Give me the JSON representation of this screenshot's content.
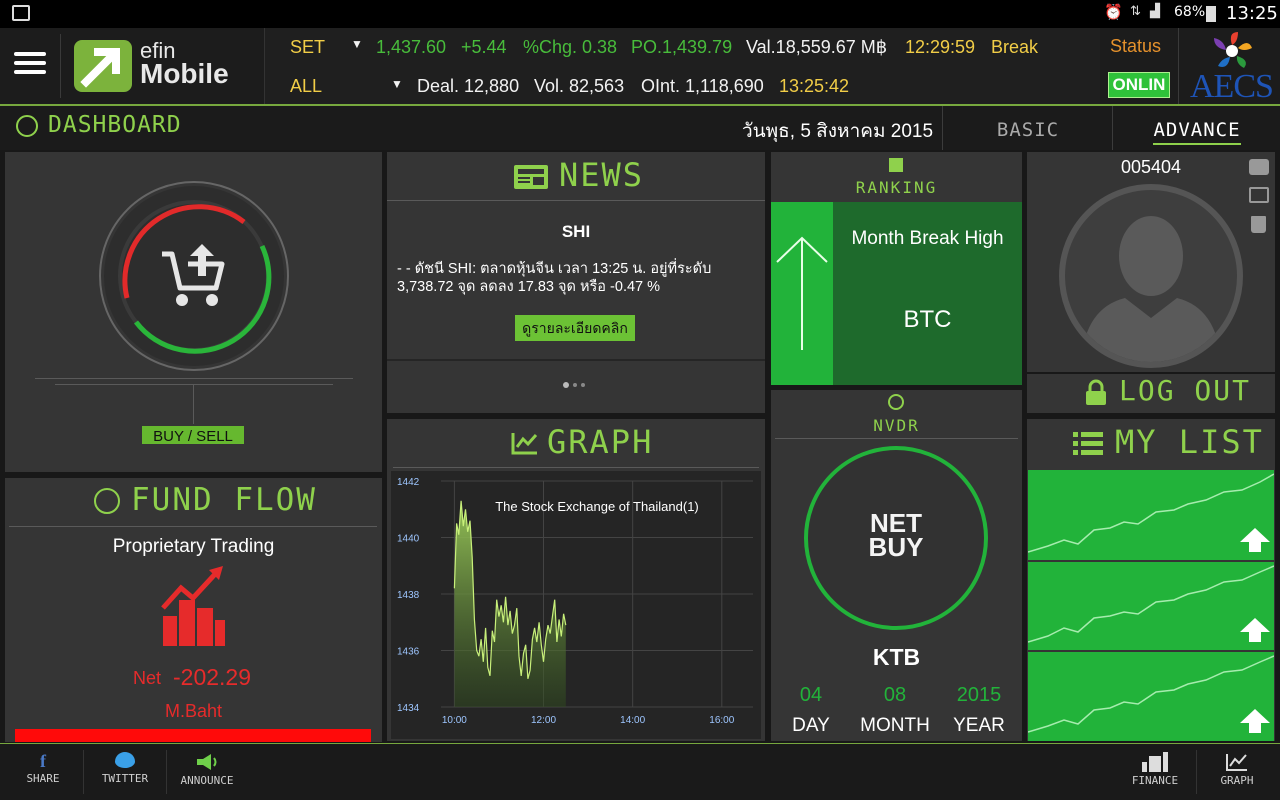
{
  "status_bar": {
    "battery": "68%",
    "time": "13:25"
  },
  "header": {
    "logo_line1": "efin",
    "logo_line2": "Mobile",
    "row1": {
      "market": "SET",
      "index": "1,437.60",
      "change": "+5.44",
      "pct_chg": "%Chg. 0.38",
      "po": "PO.1,439.79",
      "value": "Val.18,559.67 M฿",
      "time": "12:29:59",
      "state": "Break"
    },
    "row2": {
      "market": "ALL",
      "deal": "Deal. 12,880",
      "vol": "Vol. 82,563",
      "oint": "OInt. 1,118,690",
      "time": "13:25:42"
    },
    "status_label": "Status",
    "status_value": "ONLIN",
    "broker_logo": "AECS"
  },
  "dashboard": {
    "title": "DASHBOARD",
    "date": "วันพุธ, 5 สิงหาคม 2015",
    "tab_basic": "BASIC",
    "tab_advance": "ADVANCE"
  },
  "buysell": {
    "label": "BUY / SELL"
  },
  "fund_flow": {
    "title": "FUND FLOW",
    "subtitle": "Proprietary Trading",
    "net_label": "Net",
    "net_value": "-202.29",
    "unit": "M.Baht"
  },
  "news": {
    "title": "NEWS",
    "symbol": "SHI",
    "text": "- - ดัชนี SHI: ตลาดหุ้นจีน  เวลา 13:25 น.  อยู่ที่ระดับ 3,738.72 จุด ลดลง 17.83 จุด หรือ -0.47 %",
    "button": "ดูรายละเอียดคลิก"
  },
  "ranking": {
    "title": "RANKING",
    "label": "Month Break High",
    "symbol": "BTC"
  },
  "profile": {
    "id": "005404",
    "logout": "LOG OUT"
  },
  "graph": {
    "title": "GRAPH"
  },
  "nvdr": {
    "title": "NVDR",
    "circle_line1": "NET",
    "circle_line2": "BUY",
    "symbol": "KTB",
    "day": "04",
    "month": "08",
    "year": "2015",
    "day_label": "DAY",
    "month_label": "MONTH",
    "year_label": "YEAR"
  },
  "mylist": {
    "title": "MY LIST"
  },
  "bottom": {
    "share": "SHARE",
    "twitter": "TWITTER",
    "announce": "ANNOUNCE",
    "finance": "FINANCE",
    "graph": "GRAPH"
  },
  "colors": {
    "accent_green": "#8fd14c",
    "bright_green": "#22b33a",
    "red": "#e62b2b",
    "yellow": "#f1cd47"
  },
  "chart_data": {
    "type": "area",
    "title": "The Stock Exchange of Thailand(1)",
    "x_ticks": [
      "10:00",
      "12:00",
      "14:00",
      "16:00"
    ],
    "y_ticks": [
      "1442",
      "1440",
      "1438",
      "1436",
      "1434"
    ],
    "ylim": [
      1434,
      1442
    ],
    "xlim": [
      9.7,
      16.7
    ],
    "grid": true,
    "x": [
      10.0,
      10.05,
      10.1,
      10.15,
      10.2,
      10.25,
      10.3,
      10.35,
      10.4,
      10.45,
      10.5,
      10.55,
      10.6,
      10.65,
      10.7,
      10.75,
      10.8,
      10.85,
      10.9,
      10.95,
      11.0,
      11.05,
      11.1,
      11.15,
      11.2,
      11.25,
      11.3,
      11.35,
      11.4,
      11.45,
      11.5,
      11.55,
      11.6,
      11.65,
      11.7,
      11.75,
      11.8,
      11.85,
      11.9,
      11.95,
      12.0,
      12.05,
      12.1,
      12.15,
      12.2,
      12.25,
      12.3,
      12.35,
      12.4,
      12.45,
      12.5
    ],
    "values": [
      1438.2,
      1440.5,
      1440.1,
      1441.3,
      1440.4,
      1441.0,
      1440.2,
      1440.6,
      1439.3,
      1437.1,
      1436.0,
      1435.8,
      1436.4,
      1435.6,
      1436.8,
      1435.4,
      1435.1,
      1436.7,
      1436.3,
      1437.8,
      1437.2,
      1437.6,
      1437.0,
      1437.9,
      1436.9,
      1437.4,
      1436.6,
      1436.9,
      1437.5,
      1435.8,
      1435.1,
      1435.9,
      1436.2,
      1435.0,
      1435.3,
      1436.4,
      1436.8,
      1436.3,
      1437.0,
      1436.2,
      1435.6,
      1436.4,
      1436.9,
      1436.6,
      1437.2,
      1437.8,
      1436.3,
      1437.1,
      1436.5,
      1437.3,
      1436.9
    ]
  }
}
